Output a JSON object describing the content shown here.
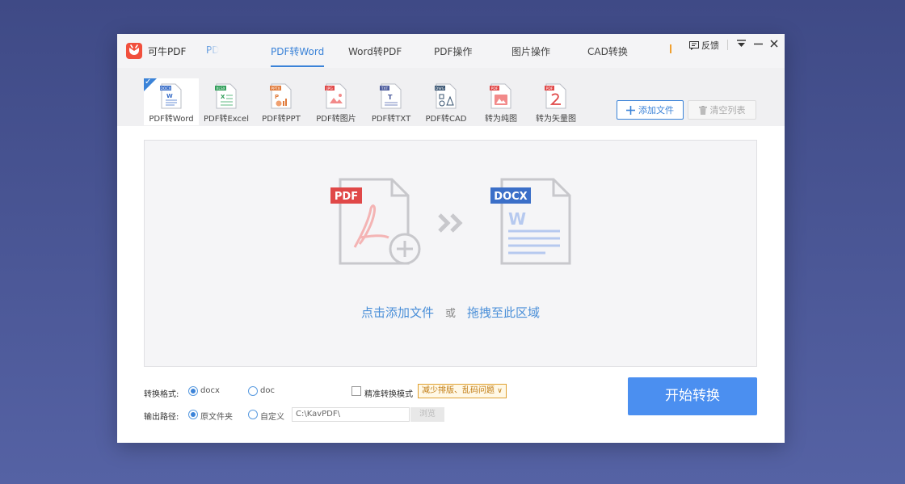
{
  "app": {
    "name": "可牛PDF"
  },
  "tabs": [
    {
      "label": "PD"
    },
    {
      "label": "PDF转Word"
    },
    {
      "label": "Word转PDF"
    },
    {
      "label": "PDF操作"
    },
    {
      "label": "图片操作"
    },
    {
      "label": "CAD转换"
    }
  ],
  "window_controls": {
    "feedback": "反馈"
  },
  "tools": [
    {
      "label": "PDF转Word",
      "badge": "DOCX",
      "color": "#3b6fc8"
    },
    {
      "label": "PDF转Excel",
      "badge": "XLSX",
      "color": "#2e9d58"
    },
    {
      "label": "PDF转PPT",
      "badge": "PPTX",
      "color": "#e07a3a"
    },
    {
      "label": "PDF转图片",
      "badge": "JPG",
      "color": "#e04848"
    },
    {
      "label": "PDF转TXT",
      "badge": "TXT",
      "color": "#4a5a9c"
    },
    {
      "label": "PDF转CAD",
      "badge": "DWG",
      "color": "#34506e"
    },
    {
      "label": "转为纯图",
      "badge": "PDF",
      "color": "#e04848"
    },
    {
      "label": "转为矢量图",
      "badge": "PDF",
      "color": "#e04848"
    }
  ],
  "actions": {
    "add_files": "添加文件",
    "clear_list": "清空列表"
  },
  "dropzone": {
    "pdf_badge": "PDF",
    "docx_badge": "DOCX",
    "click_add": "点击添加文件",
    "or": "或",
    "drag_here": "拖拽至此区域"
  },
  "options": {
    "format_label": "转换格式:",
    "format_options": [
      "docx",
      "doc"
    ],
    "format_selected": "docx",
    "precise_mode_label": "精准转换模式",
    "precise_mode_hint": "减少排版、乱码问题",
    "output_label": "输出路径:",
    "output_options": [
      "原文件夹",
      "自定义"
    ],
    "output_selected": "原文件夹",
    "output_path": "C:\\KavPDF\\",
    "browse": "浏览"
  },
  "start_button": "开始转换",
  "colors": {
    "accent": "#3b83d8",
    "start_button": "#4b8ff0",
    "brand": "#f1503d"
  }
}
